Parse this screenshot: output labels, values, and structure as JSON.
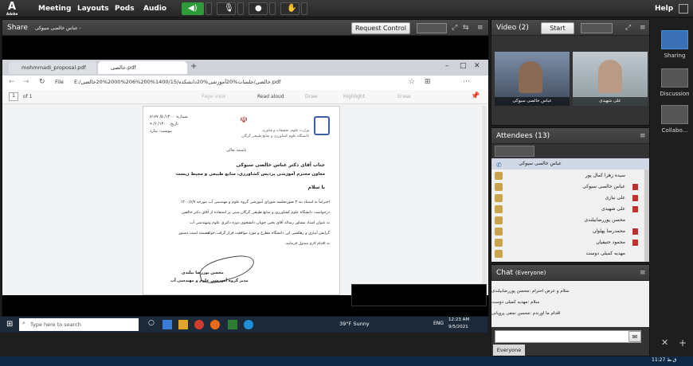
{
  "menubar": {
    "items": [
      "Meeting",
      "Layouts",
      "Pods",
      "Audio"
    ],
    "help": "Help",
    "logo_text": "Adobe"
  },
  "share": {
    "title": "Share",
    "subtitle": "عباس خالصی سیوکی -",
    "request_control": "Request Control"
  },
  "browser": {
    "tabs": [
      "mohmmadi_proposal.pdf",
      "خالصی.pdf"
    ],
    "address_prefix": "File",
    "address": "E:/خالصی/جلسات%20آموزشی%20دانشکده/1400/15%200%206%2000%20خالصی.pdf",
    "page": "1",
    "of": "of 1",
    "tools": [
      "Page view",
      "Read aloud",
      "Draw",
      "Highlight",
      "Erase"
    ]
  },
  "letter": {
    "number_label": "شماره:",
    "number": "۱۴۰۰/ ۵/ ۸۱۷۷",
    "date_label": "تاریخ:",
    "date": "۱۴۰۰/ ۶/ ۹",
    "attach": "پیوست: ندارد",
    "ministry": "وزارت علوم، تحقیقات و فناوری",
    "university": "دانشگاه علوم کشاورزی و منابع طبیعی گرگان",
    "bismillah": "باسمه تعالی",
    "recipient": "جناب آقای دکتر عباس خالصی سیوکی",
    "recipient_title": "معاون محترم آموزشی پردیس کشاورزی، منابع طبیعی و محیط زیست",
    "greeting": "با سلام",
    "body": [
      "احتراماً به استناد بند ۳ صورتجلسه شورای آموزشی گروه علوم و مهندسی آب مورخه ۱۴۰۰/۶/۷",
      "درخواست دانشگاه علوم کشاورزی و منابع طبیعی گرگان مبنی بر استفاده از آقای دکتر خالصی",
      "به عنوان استاد مشاور رساله آقای یحیی چوپان دانشجوی دوره دکتری علوم ومهندسی آب",
      "گرایش آبیاری و زهکشی این دانشگاه مطرح و مورد موافقت قرار گرفت.خواهشمند است دستور",
      "به اقدام لازم مبذول فرمایید."
    ],
    "signer": "محسن پوررضا بیلندی",
    "signer_title": "مدیر گروه آموزشی علوم و مهندسی آب"
  },
  "taskbar": {
    "search": "Type here to search",
    "weather": "39°F Sunny",
    "lang": "ENG",
    "time": "12:23 AM",
    "date": "9/5/2021"
  },
  "video": {
    "title": "Video",
    "count": "(2)",
    "start": "Start",
    "names": [
      "عباس خالصی سیوکی",
      "علی شهیدی"
    ]
  },
  "attendees": {
    "title": "Attendees",
    "count": "(13)",
    "host": "عباس خالصی سیوکی",
    "list": [
      "سیده زهرا کمال پور",
      "عباس خالصی سیوکی",
      "علی نیازی",
      "علی شهیدی",
      "محسن پوررضابیلندی",
      "محمدرضا پهلوان",
      "محمود حنیفیان",
      "مهدیه کمیلی دوست"
    ]
  },
  "chat": {
    "title": "Chat",
    "scope": "(Everyone)",
    "messages": [
      "سلام و عرض احترام :محسن پوررضابیلندی",
      "سلام :مهدیه کمیلی دوست",
      "اقدام ما اورندم :محسن نجفی پرویانی"
    ],
    "tab": "Everyone"
  },
  "sidebar": {
    "items": [
      "Sharing",
      "Discussion",
      "Collabo..."
    ]
  },
  "clock": "11:27 ق.ظ"
}
